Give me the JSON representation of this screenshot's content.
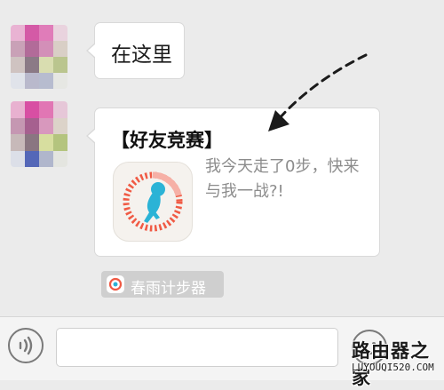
{
  "chat": {
    "messages": [
      {
        "text": "在这里"
      },
      {
        "card_title": "【好友竞赛】",
        "card_desc": "我今天走了0步，快来与我一战?!",
        "app_icon": "running-ring-icon"
      }
    ],
    "source_app": "春雨计步器"
  },
  "input_bar": {
    "voice_icon": "voice-icon",
    "emoji_icon": "emoji-icon"
  },
  "watermark": {
    "main": "路由器之家",
    "sub": "LUYOUQI520.COM"
  },
  "colors": {
    "background": "#ebebeb",
    "bubble": "#ffffff",
    "desc_text": "#8c8c8c",
    "ring_accent": "#f05a44",
    "figure": "#2bb3d6",
    "source_badge": "#cfcfcf"
  }
}
